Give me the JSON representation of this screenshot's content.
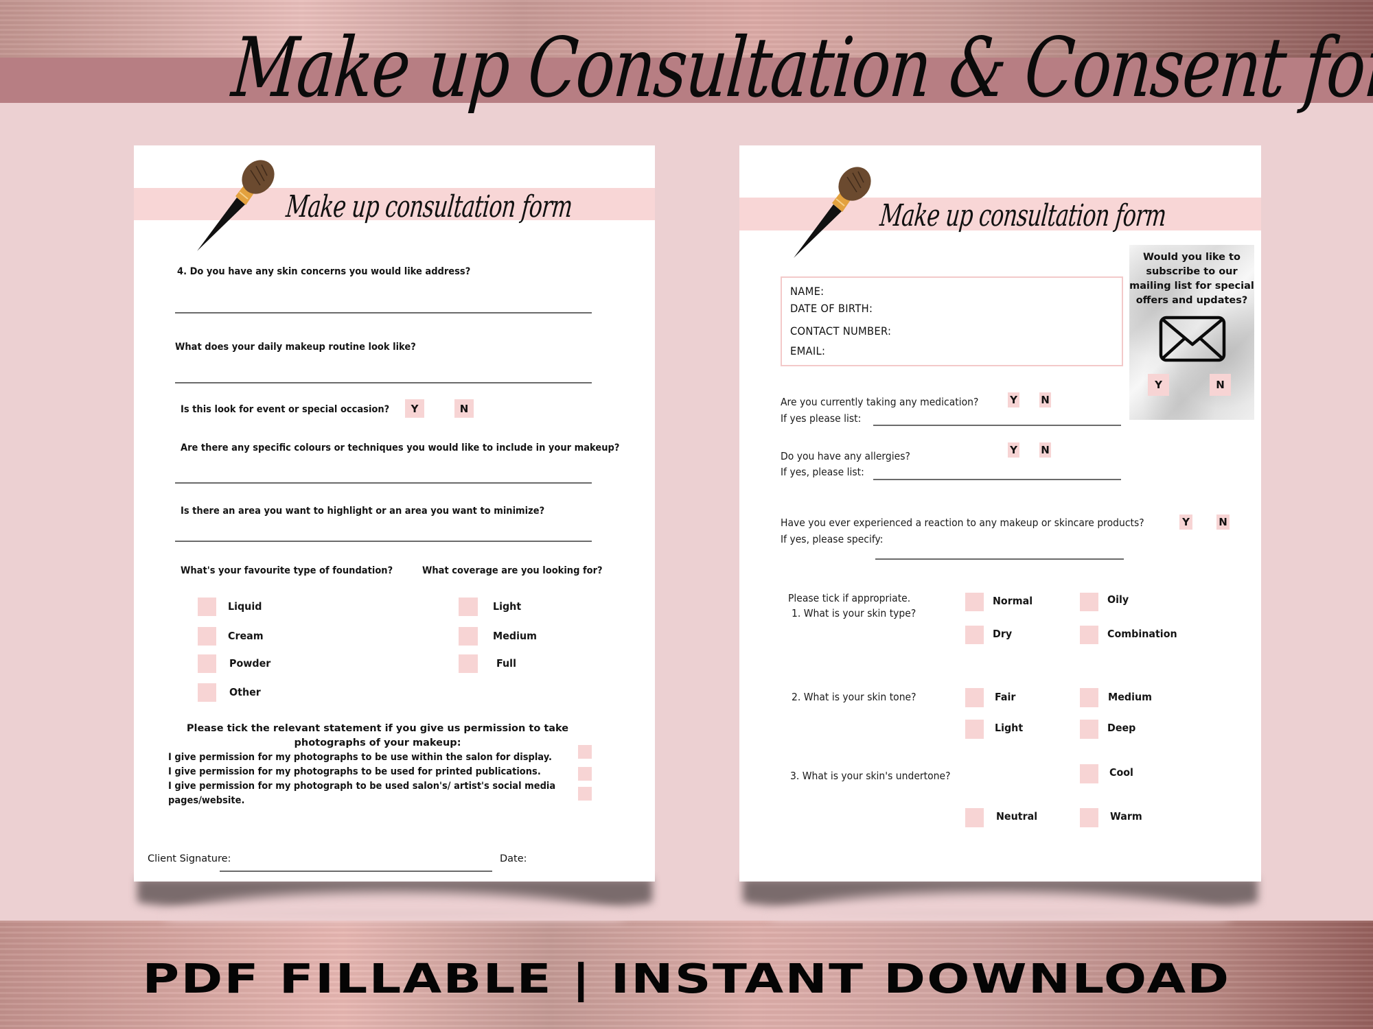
{
  "banner": {
    "title": "Make up Consultation & Consent form",
    "footer": "PDF FILLABLE | INSTANT DOWNLOAD"
  },
  "colors": {
    "background": "#ecd0d2",
    "mauve_band": "#b77e83",
    "header_band": "#f8d6d6",
    "checkbox": "#f7d4d4"
  },
  "left_page": {
    "icon": "makeup-brush-icon",
    "header_title": "Make up consultation form",
    "questions": [
      {
        "text": "4. Do you have any skin concerns you would like address?"
      },
      {
        "text": "What does your daily makeup routine look like?"
      },
      {
        "text": "Is this look for event or special occasion?",
        "yes": "Y",
        "no": "N"
      },
      {
        "text": "Are there any specific colours or techniques you would like to include in your makeup?"
      },
      {
        "text": "Is there an area you want to highlight or an area you want to minimize?"
      }
    ],
    "foundation": {
      "question": "What's your favourite type of foundation?",
      "options": [
        "Liquid",
        "Cream",
        "Powder",
        "Other"
      ]
    },
    "coverage": {
      "question": "What coverage are you looking for?",
      "options": [
        "Light",
        "Medium",
        "Full"
      ]
    },
    "permissions": {
      "heading": "Please tick the relevant statement if you give us permission to take photographs of your makeup:",
      "statements": [
        "I give permission for my photographs to be use within the salon for display.",
        "I give permission for my photographs to be used for printed publications.",
        "I give permission for my photograph to be used salon's/ artist's social media",
        "pages/website."
      ]
    },
    "signature_label": "Client Signature:",
    "date_label": "Date:"
  },
  "right_page": {
    "icon": "makeup-brush-icon",
    "header_title": "Make up consultation form",
    "contact": {
      "name": "NAME:",
      "dob": "DATE OF BIRTH:",
      "phone": "CONTACT NUMBER:",
      "email": "EMAIL:"
    },
    "mailing": {
      "question": "Would you like to subscribe to our mailing list for special offers and updates?",
      "icon": "envelope-icon",
      "yes": "Y",
      "no": "N"
    },
    "medication": {
      "question": "Are you currently taking any medication?",
      "follow": "If yes please list:",
      "yes": "Y",
      "no": "N"
    },
    "allergies": {
      "question": "Do you have any allergies?",
      "follow": "If yes, please list:",
      "yes": "Y",
      "no": "N"
    },
    "reaction": {
      "question": "Have you ever experienced a reaction to any makeup or skincare products?",
      "follow": "If yes, please specify:",
      "yes": "Y",
      "no": "N"
    },
    "tick_intro": "Please tick if appropriate.",
    "skin_type": {
      "question": "1. What is your skin type?",
      "options": [
        "Normal",
        "Oily",
        "Dry",
        "Combination"
      ]
    },
    "skin_tone": {
      "question": "2. What is your skin tone?",
      "options": [
        "Fair",
        "Medium",
        "Light",
        "Deep"
      ]
    },
    "undertone": {
      "question": "3. What is your skin's undertone?",
      "options": [
        "Cool",
        "Neutral",
        "Warm"
      ]
    }
  }
}
